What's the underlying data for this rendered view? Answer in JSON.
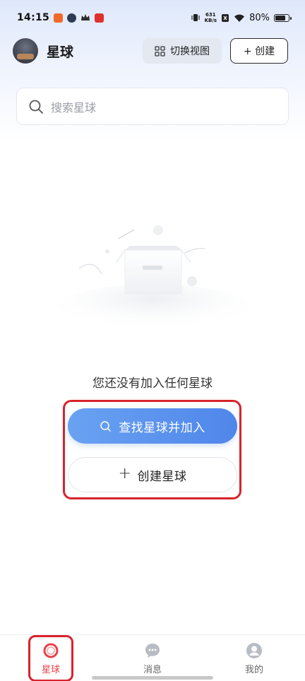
{
  "status_bar": {
    "time": "14:15",
    "net_speed_value": "631",
    "net_speed_unit": "KB/s",
    "battery": "80%"
  },
  "header": {
    "title": "星球",
    "switch_view_label": "切换视图",
    "create_label": "+ 创建"
  },
  "search": {
    "placeholder": "搜索星球"
  },
  "empty_state": {
    "message": "您还没有加入任何星球",
    "find_join_label": "查找星球并加入",
    "create_planet_label": "创建星球"
  },
  "bottom_nav": {
    "items": [
      {
        "label": "星球",
        "icon": "planet-icon",
        "active": true
      },
      {
        "label": "消息",
        "icon": "message-icon",
        "active": false
      },
      {
        "label": "我的",
        "icon": "profile-icon",
        "active": false
      }
    ]
  },
  "colors": {
    "accent_blue": "#4f86ea",
    "active_red": "#e8404a",
    "highlight_red": "#d8232c"
  }
}
